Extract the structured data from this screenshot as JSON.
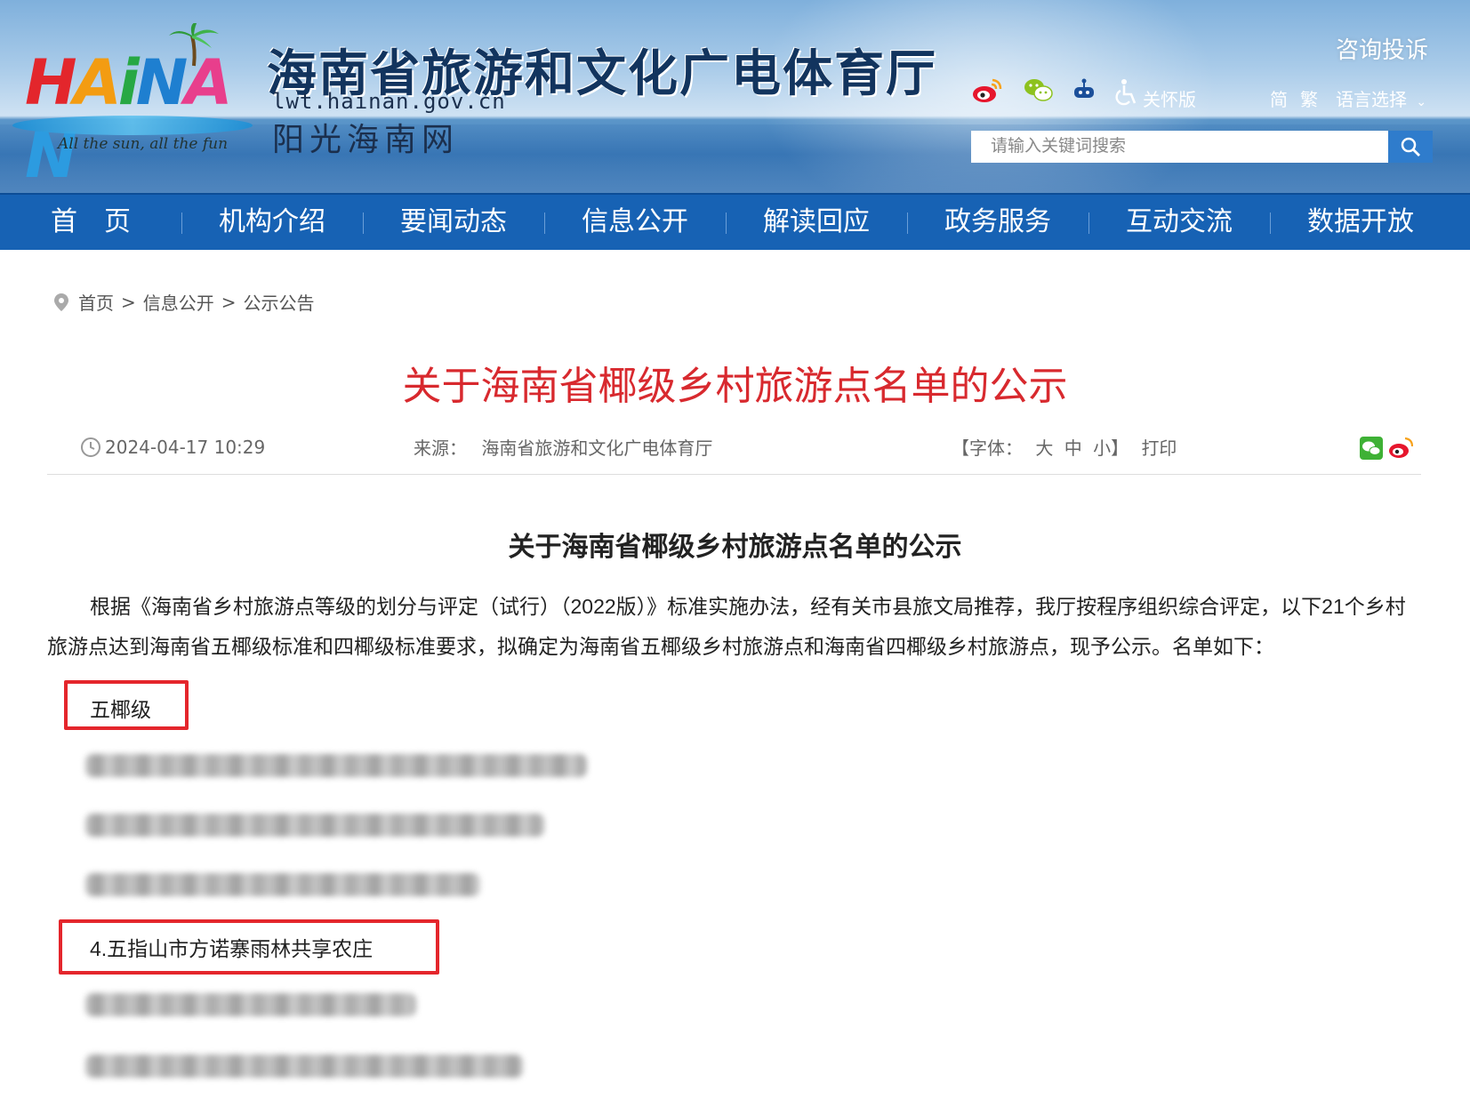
{
  "header": {
    "logo_text": "HAINAN",
    "logo_tagline": "All the sun, all the fun",
    "site_title": "海南省旅游和文化广电体育厅",
    "site_domain": "lwt.hainan.gov.cn",
    "site_subtitle": "阳光海南网",
    "complaint_label": "咨询投诉",
    "care_label": "关怀版",
    "lang_simplified": "简",
    "lang_traditional": "繁",
    "lang_select": "语言选择",
    "search_placeholder": "请输入关键词搜索",
    "icons": [
      "weibo-icon",
      "wechat-icon",
      "robot-icon",
      "accessibility-icon",
      "search-icon"
    ]
  },
  "nav": {
    "items": [
      "首　页",
      "机构介绍",
      "要闻动态",
      "信息公开",
      "解读回应",
      "政务服务",
      "互动交流",
      "数据开放"
    ]
  },
  "breadcrumb": [
    "首页",
    "信息公开",
    "公示公告"
  ],
  "article": {
    "title": "关于海南省椰级乡村旅游点名单的公示",
    "date": "2024-04-17 10:29",
    "source_label": "来源：",
    "source": "海南省旅游和文化广电体育厅",
    "font_label_open": "【字体：",
    "font_large": "大",
    "font_medium": "中",
    "font_small": "小",
    "font_label_close": "】",
    "print_label": "打印",
    "heading": "关于海南省椰级乡村旅游点名单的公示",
    "paragraph": "根据《海南省乡村旅游点等级的划分与评定（试行）（2022版）》标准实施办法，经有关市县旅文局推荐，我厅按程序组织综合评定，以下21个乡村旅游点达到海南省五椰级标准和四椰级标准要求，拟确定为海南省五椰级乡村旅游点和海南省四椰级乡村旅游点，现予公示。名单如下：",
    "section_five": "五椰级",
    "highlighted_item": "4.五指山市方诺寨雨林共享农庄"
  },
  "colors": {
    "nav_bg": "#1762b4",
    "title_red": "#d8292e",
    "highlight_red": "#e4262c"
  }
}
